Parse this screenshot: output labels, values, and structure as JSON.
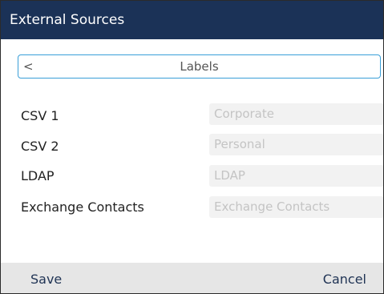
{
  "header": {
    "title": "External Sources"
  },
  "tab": {
    "back_icon": "chevron-left-icon",
    "back_glyph": "<",
    "title": "Labels"
  },
  "rows": [
    {
      "label": "CSV 1",
      "placeholder": "Corporate"
    },
    {
      "label": "CSV 2",
      "placeholder": "Personal"
    },
    {
      "label": "LDAP",
      "placeholder": "LDAP"
    },
    {
      "label": "Exchange Contacts",
      "placeholder": "Exchange Contacts"
    }
  ],
  "footer": {
    "save_label": "Save",
    "cancel_label": "Cancel"
  },
  "colors": {
    "titlebar": "#1b3257",
    "accent_border": "#3a9fd8",
    "footer_bg": "#e6e6e6",
    "field_bg": "#f2f2f2",
    "placeholder_text": "#c4c4c4"
  }
}
